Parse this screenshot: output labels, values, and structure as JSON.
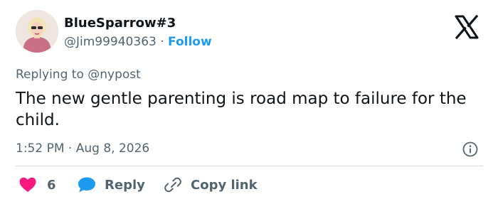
{
  "author": {
    "display_name": "BlueSparrow#3",
    "handle": "@Jim99940363",
    "separator": "·",
    "follow_label": "Follow"
  },
  "reply_context": {
    "prefix": "Replying to",
    "mention": "@nypost"
  },
  "tweet": {
    "text": "The new gentle parenting is road map to failure for the child.",
    "time": "1:52 PM",
    "separator": "·",
    "date": "Aug 8, 2026"
  },
  "actions": {
    "like_count": "6",
    "reply_label": "Reply",
    "copy_link_label": "Copy link"
  },
  "icons": {
    "brand": "x-logo-icon",
    "info": "info-icon",
    "like": "heart-icon",
    "reply": "speech-bubble-icon",
    "copy": "link-icon"
  },
  "colors": {
    "like": "#f91880",
    "reply": "#1d9bf0",
    "follow": "#1d9bf0",
    "muted": "#536471",
    "text": "#0f1419"
  }
}
